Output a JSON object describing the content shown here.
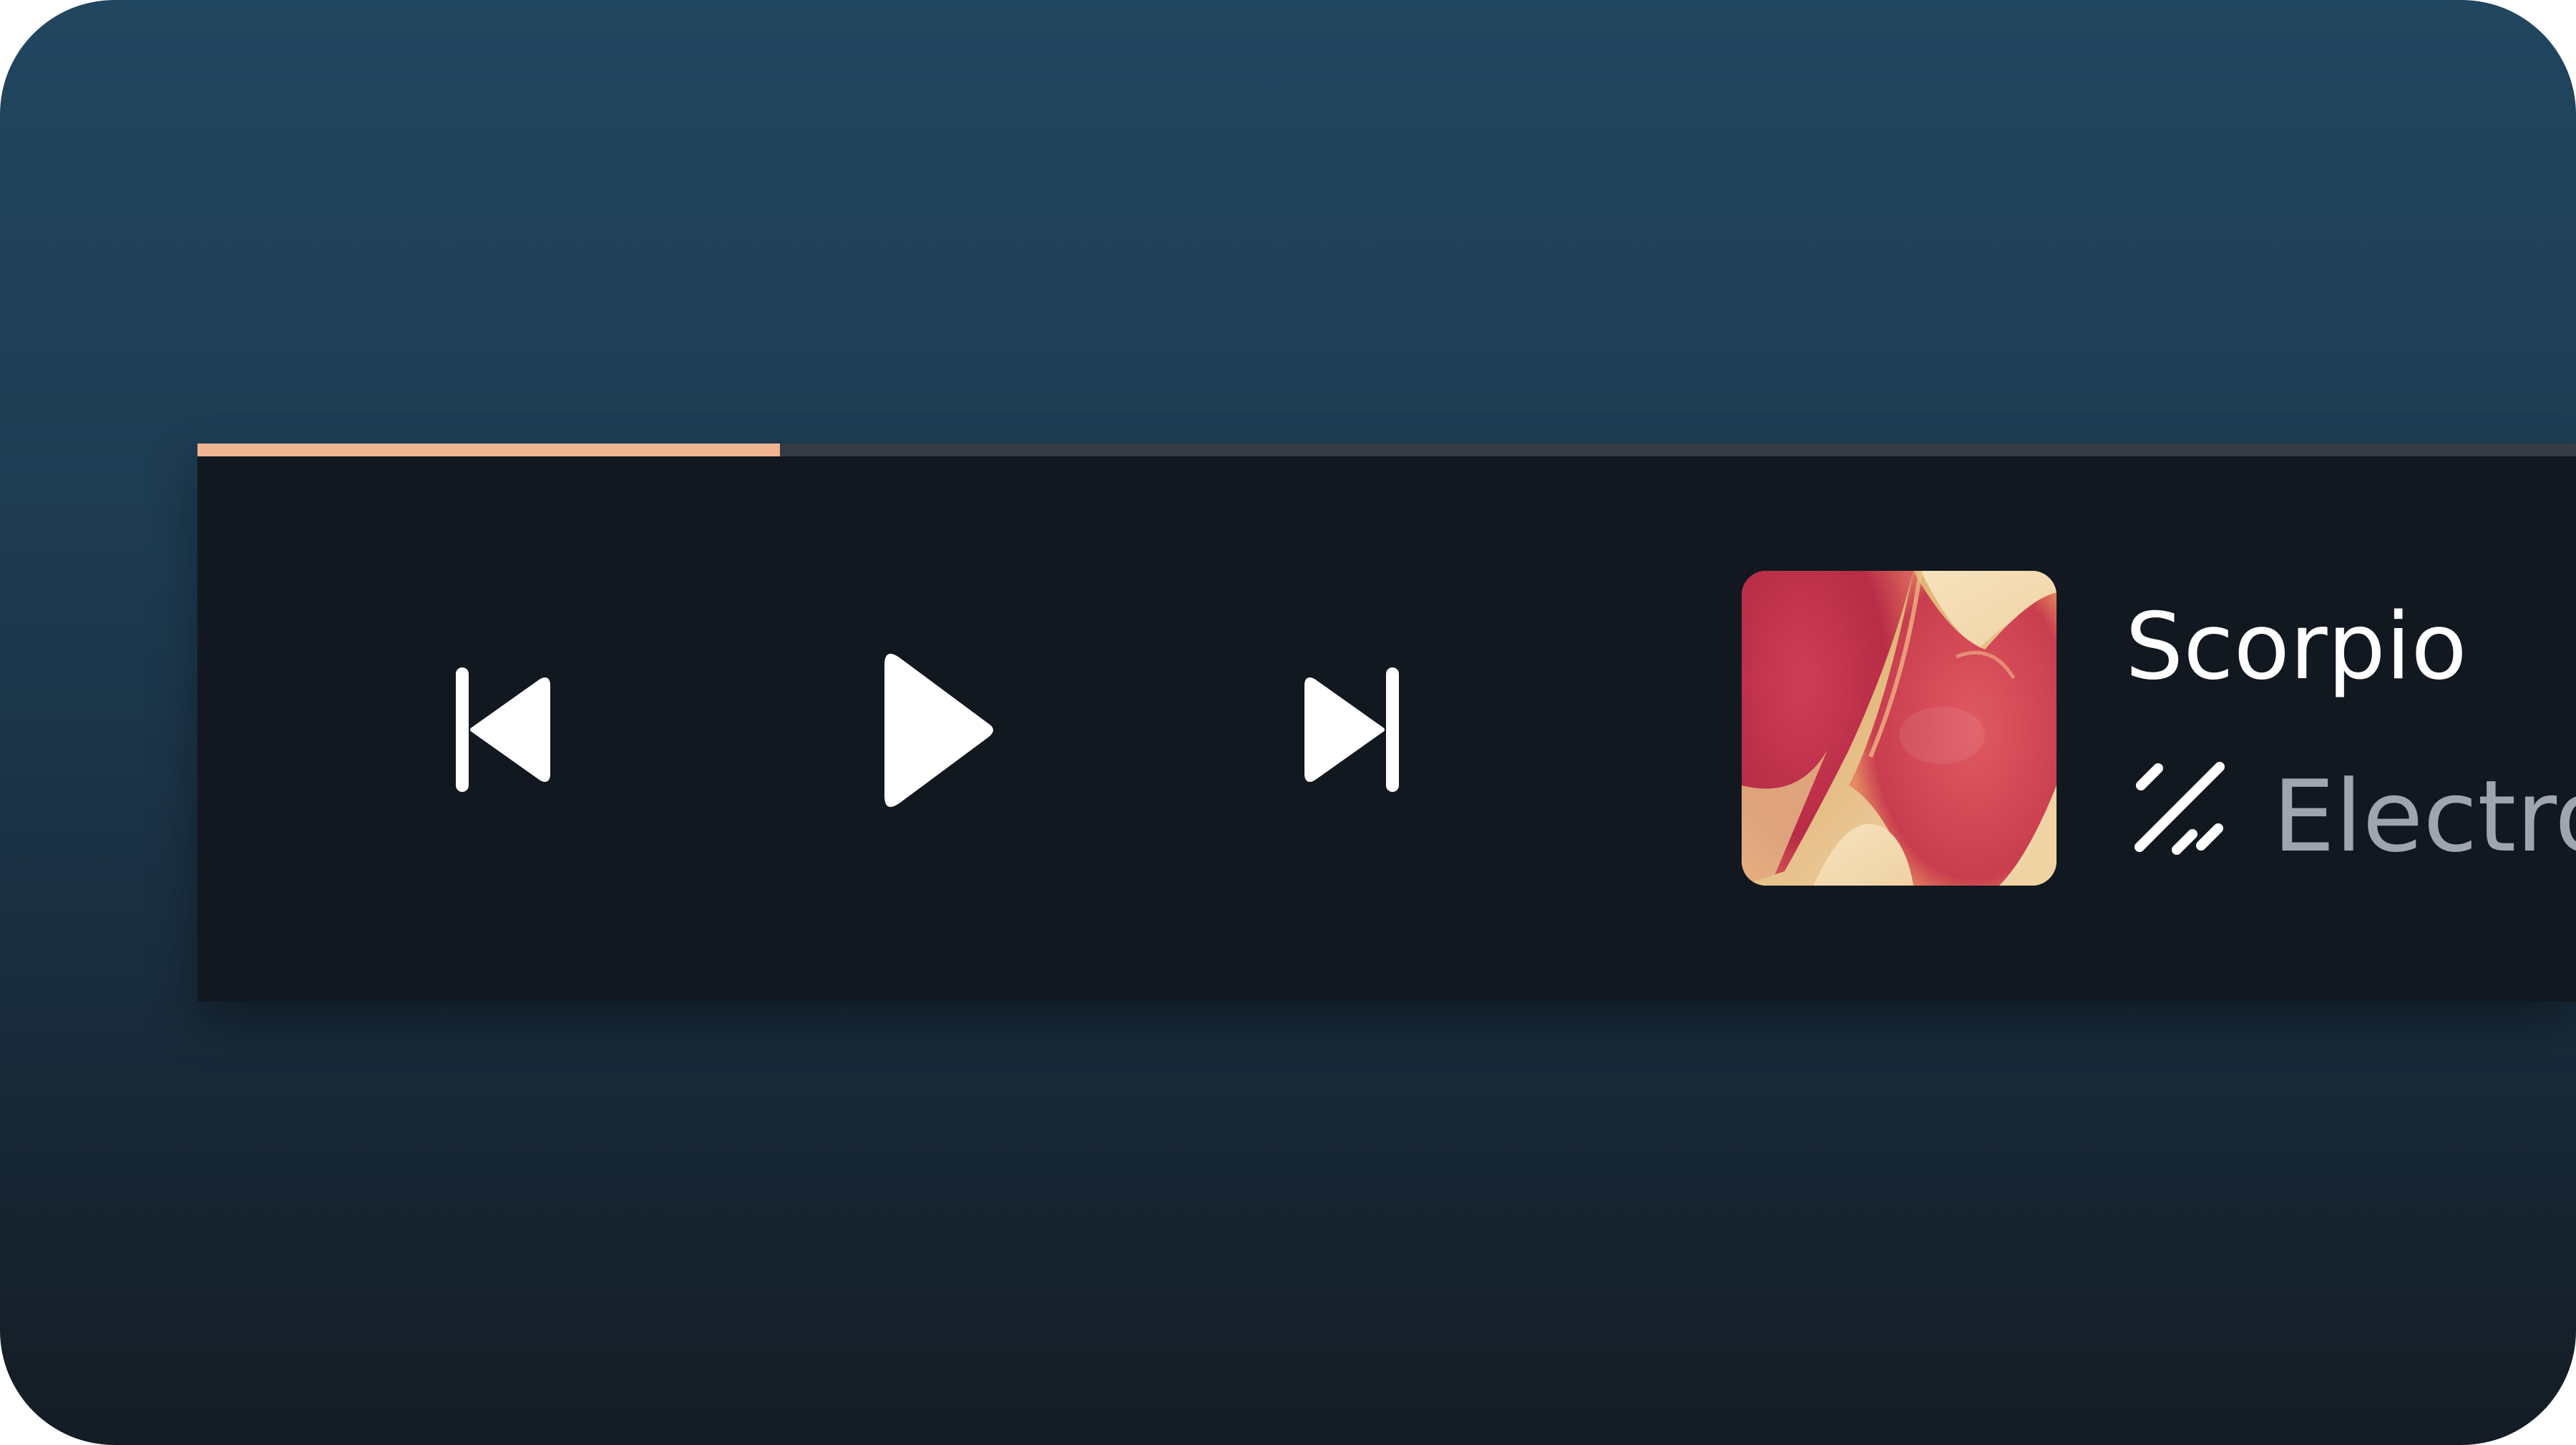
{
  "player": {
    "progress": 0.245,
    "colors": {
      "progress_fill": "#f0b592",
      "progress_track": "#353c46",
      "panel": "#121820",
      "background_top": "#21465f",
      "background_bottom": "#141c24"
    },
    "controls": {
      "previous_icon": "skip-previous-icon",
      "play_icon": "play-icon",
      "next_icon": "skip-next-icon"
    },
    "track": {
      "title": "Scorpio",
      "genre": "Electro",
      "genre_icon": "sparkle-lines-icon",
      "album_art": "abstract-red-cream-fluid-art"
    }
  }
}
